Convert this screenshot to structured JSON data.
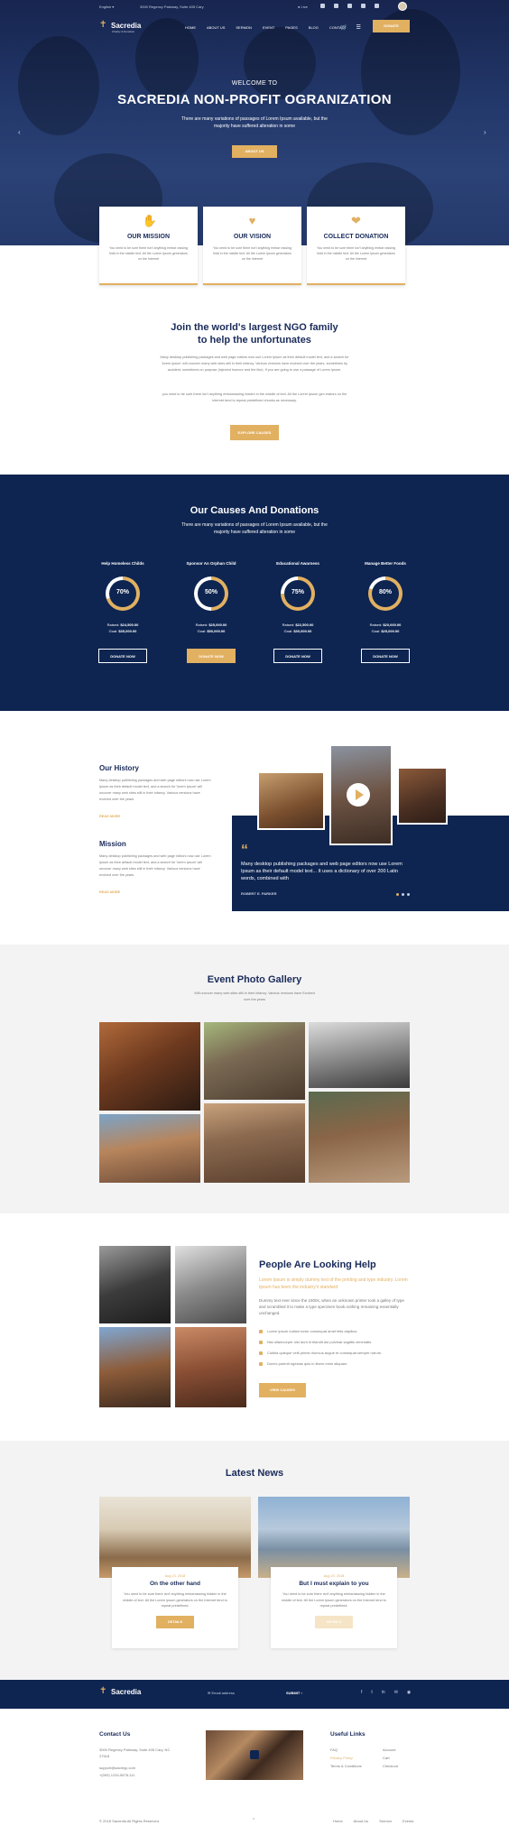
{
  "topbar": {
    "language": "English",
    "address": "3000 Regency Parkway, Suite 405 Cary",
    "live_label": "Live"
  },
  "brand": {
    "name": "Sacredia",
    "tagline": "Charity & Donation"
  },
  "menu": [
    "HOME",
    "ABOUT US",
    "SERMON",
    "EVENT",
    "PAGES",
    "BLOG",
    "CONTACT"
  ],
  "cart_count": "0",
  "donate_label": "DONATE",
  "hero": {
    "kicker": "WELCOME TO",
    "title": "SACREDIA NON-PROFIT OGRANIZATION",
    "text": "There are many variations of passages of Lorem Ipsum available, but the majority have suffered alteration in some",
    "button": "ABOUT US"
  },
  "features": [
    {
      "icon": "hands-icon",
      "title": "OUR MISSION",
      "text": "You need to be sure there isn't anything embar rassing hidd in the middle text. All the Lorem Ipsum generators on the Internet"
    },
    {
      "icon": "heart-icon",
      "title": "OUR VISION",
      "text": "You need to be sure there isn't anything embar rassing hidd in the middle text. All the Lorem Ipsum generators on the Internet"
    },
    {
      "icon": "donation-icon",
      "title": "COLLECT DONATION",
      "text": "You need to be sure there isn't anything embar rassing hidd in the middle text. All the Lorem Ipsum generators on the Internet"
    }
  ],
  "join": {
    "title_line1": "Join the world's largest NGO family",
    "title_line2": "to help the unfortunates",
    "p1": "Many desktop publishing packages and web page editors now use Lorem Ipsum as their default model text, and a search for 'lorem ipsum' will uncover many web sites still in their infancy. Various versions have evolved over the years, sometimes by accident, sometimes on purpose (injected humour and the like). If you are going to use a passage of Lorem Ipsum.",
    "p2": "you need to be sure there isn't anything embarrassing hidden in the middle of text. All the Lorem Ipsum gen erators on the Internet tend to repeat predefined chunks as necessary.",
    "button": "EXPLORE CAUSES"
  },
  "causes": {
    "title": "Our Causes And Donations",
    "subtitle": "There are many variations of passages of Lorem Ipsum available, but the majority have suffered alteration in some",
    "items": [
      {
        "name": "Help Homeless Childs",
        "percent": "70%",
        "raised_label": "Raised:",
        "raised": "$24,500.00",
        "goal_label": "Goal:",
        "goal": "$35,000.00",
        "button": "DONATE NOW"
      },
      {
        "name": "Sponsor An Orphan Child",
        "percent": "50%",
        "raised_label": "Raised:",
        "raised": "$25,000.00",
        "goal_label": "Goal:",
        "goal": "$50,000.00",
        "button": "DONATE NOW"
      },
      {
        "name": "Educational Awarness",
        "percent": "75%",
        "raised_label": "Raised:",
        "raised": "$22,500.00",
        "goal_label": "Goal:",
        "goal": "$30,000.00",
        "button": "DONATE NOW"
      },
      {
        "name": "Manage Better Foods",
        "percent": "80%",
        "raised_label": "Raised:",
        "raised": "$20,000.00",
        "goal_label": "Goal:",
        "goal": "$25,000.00",
        "button": "DONATE NOW"
      }
    ],
    "progress": [
      0.7,
      0.5,
      0.75,
      0.8
    ]
  },
  "history": {
    "title": "Our History",
    "text": "Many desktop publishing packages and web page editors now use Lorem Ipsum as their default model text, and a search for 'lorem ipsum' will uncover many web sites still in their infancy. Various versions have evolved over the years.",
    "read_more": "READ MORE",
    "mission_title": "Mission",
    "mission_text": "Many desktop publishing packages and web page editors now use Lorem Ipsum as their default model text, and a search for 'lorem ipsum' will uncover many web sites still in their infancy. Various versions have evolved over the years.",
    "mission_read_more": "READ MORE",
    "quote": "Many desktop publishing packages and web page editors now use Lorem Ipsum as their default model text... It uses a dictionary of over 200 Latin words, combined with",
    "quote_author": "ROBERT E. PARKER"
  },
  "gallery": {
    "title": "Event Photo Gallery",
    "subtitle": "Will uncover many web sites still in their infancy. Various versions have Evolved over the years"
  },
  "help": {
    "title": "People Are Looking Help",
    "lead": "Lorem Ipsum is simply dummy text of the printing and type industry. Lorem Ipsum has been the industry's standard",
    "text": "Dummy text ever since the 1500s, when an unknown printer took a galley of type and scrambled it to make a type specimen book.nothing remaining essentially unchanged.",
    "list": [
      "Lorem ipsum nullam tortor consequat amet felis dapibus.",
      "Nisi ullamcorper nisi dunt id blandit dui pulvinar sagittis venenatis.",
      "Cubilia quisque velit primis rhoncus augue et consequat semper rutrum.",
      "Donec potenti egestas quis in libero enim aliquam."
    ],
    "button": "VIEW CAUSES"
  },
  "news": {
    "title": "Latest News",
    "items": [
      {
        "date": "Aug 23, 2018",
        "title": "On the other hand",
        "text": "You need to be sure there isn't anything embarrassing hidden in the middle of text. All the Lorem Ipsum generators on the Internet tend to repeat predefined.",
        "button": "DETAILS"
      },
      {
        "date": "Aug 23, 2018",
        "title": "But I must explain to you",
        "text": "You need to be sure there isn't anything embarrassing hidden in the middle of text. All the Lorem Ipsum generators on the Internet tend to repeat predefined.",
        "button": "DETAILS"
      }
    ]
  },
  "footer": {
    "email_placeholder": "Email address",
    "submit": "SUBMIT",
    "contact_title": "Contact Us",
    "address": "3000 Regency Parkway, Suite 405 Cary, NC 27518",
    "email": "support@sacreyp.com",
    "phone": "+(000) 1234-5678-111",
    "links_title": "Useful Links",
    "links_col1": [
      "FAQ",
      "Privacy Policy",
      "Terms & Conditions"
    ],
    "links_col2": [
      "Account",
      "Cart",
      "Checkout"
    ],
    "copyright": "© 2018 Sacredia All Rights Reserved",
    "bottom_links": [
      "Home",
      "About Us",
      "Sermon",
      "Events"
    ]
  },
  "colors": {
    "navy": "#0e2551",
    "gold": "#e1b061",
    "heading": "#1a2b5a"
  }
}
